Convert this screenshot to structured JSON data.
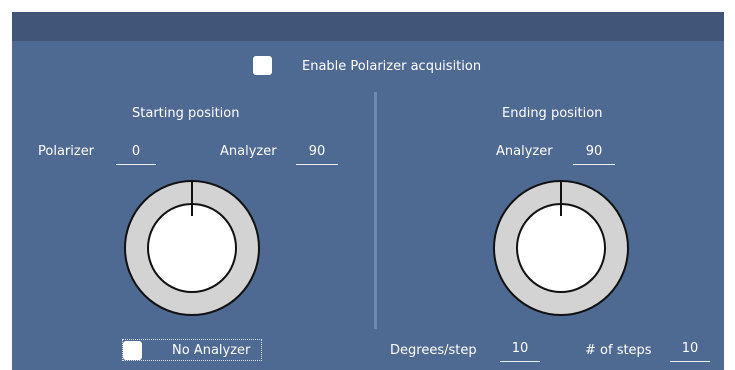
{
  "enable_polarizer": {
    "label": "Enable Polarizer acquisition",
    "checked": false
  },
  "starting": {
    "title": "Starting position",
    "polarizer_label": "Polarizer",
    "polarizer_value": "0",
    "analyzer_label": "Analyzer",
    "analyzer_value": "90"
  },
  "ending": {
    "title": "Ending position",
    "analyzer_label": "Analyzer",
    "analyzer_value": "90"
  },
  "no_analyzer": {
    "label": "No Analyzer",
    "checked": false
  },
  "degrees_per_step": {
    "label": "Degrees/step",
    "value": "10"
  },
  "num_steps": {
    "label": "# of steps",
    "value": "10"
  },
  "colors": {
    "panel": "#4f6a92",
    "header": "#3f5678",
    "dial_ring": "#d3d3d3",
    "dial_face": "#ffffff",
    "dial_outline": "#111111"
  }
}
